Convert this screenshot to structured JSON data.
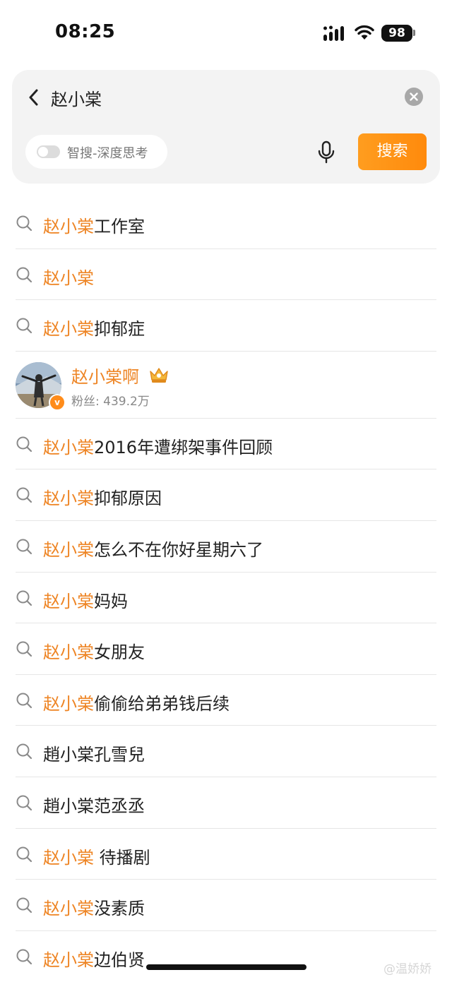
{
  "status_bar": {
    "time": "08:25",
    "battery": "98",
    "signal_icon": "cellular-signal-icon",
    "wifi_icon": "wifi-icon"
  },
  "search": {
    "query": "赵小棠",
    "deep_think_label": "智搜-深度思考",
    "deep_think_enabled": false,
    "search_button_label": "搜索"
  },
  "colors": {
    "highlight": "#ee8525",
    "button": "#ff9419",
    "text": "#222222"
  },
  "suggestions": [
    {
      "highlight": "赵小棠",
      "rest": "工作室"
    },
    {
      "highlight": "赵小棠",
      "rest": ""
    },
    {
      "highlight": "赵小棠",
      "rest": "抑郁症"
    },
    {
      "type": "user",
      "name": "赵小棠啊",
      "fans": "粉丝: 439.2万"
    },
    {
      "highlight": "赵小棠",
      "rest": "2016年遭绑架事件回顾"
    },
    {
      "highlight": "赵小棠",
      "rest": "抑郁原因"
    },
    {
      "highlight": "赵小棠",
      "rest": "怎么不在你好星期六了"
    },
    {
      "highlight": "赵小棠",
      "rest": "妈妈"
    },
    {
      "highlight": "赵小棠",
      "rest": "女朋友"
    },
    {
      "highlight": "赵小棠",
      "rest": "偷偷给弟弟钱后续"
    },
    {
      "highlight": "",
      "rest": "趙小棠孔雪兒"
    },
    {
      "highlight": "",
      "rest": "趙小棠范丞丞"
    },
    {
      "highlight": "赵小棠",
      "rest": " 待播剧"
    },
    {
      "highlight": "赵小棠",
      "rest": "没素质"
    },
    {
      "highlight": "赵小棠",
      "rest": "边伯贤"
    }
  ],
  "watermark": "@温娇娇"
}
